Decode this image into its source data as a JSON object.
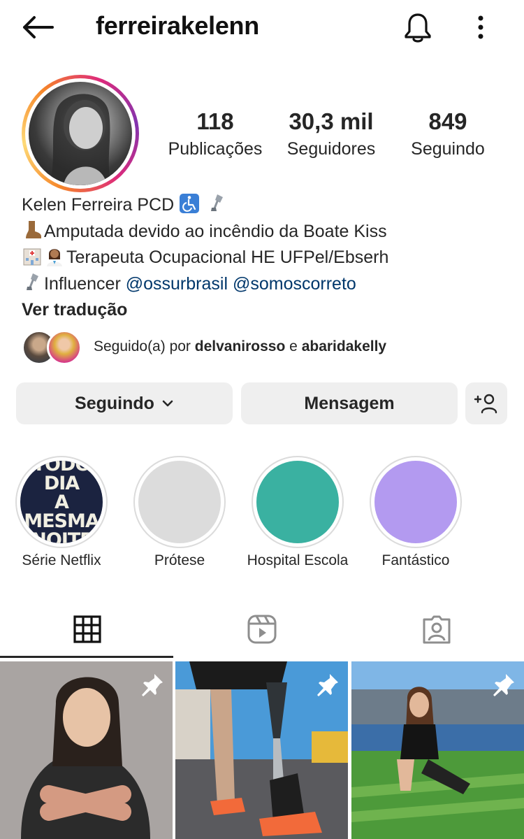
{
  "header": {
    "username": "ferreirakelenn",
    "icons": {
      "back": "arrow-left-icon",
      "notifications": "bell-icon",
      "more": "more-vertical-icon"
    }
  },
  "stats": [
    {
      "value": "118",
      "label": "Publicações"
    },
    {
      "value": "30,3 mil",
      "label": "Seguidores"
    },
    {
      "value": "849",
      "label": "Seguindo"
    }
  ],
  "bio": {
    "name": "Kelen Ferreira PCD",
    "line1": "Amputada devido ao incêndio da Boate Kiss",
    "line2": "Terapeuta Ocupacional HE UFPel/Ebserh",
    "line3_text": "Influencer",
    "mention1": "@ossurbrasil",
    "mention2": "@somoscorreto",
    "translate": "Ver tradução"
  },
  "followed_by": {
    "prefix": "Seguido(a) por",
    "user1": "delvanirosso",
    "conjunction": "e",
    "user2": "abaridakelly"
  },
  "actions": {
    "following": "Seguindo",
    "message": "Mensagem",
    "add_user_icon": "add-user-icon"
  },
  "highlights": [
    {
      "label": "Série Netflix",
      "cover_text": [
        "TODO DIA",
        "A MESMA",
        "NOITE"
      ],
      "color": "#1b2340"
    },
    {
      "label": "Prótese",
      "color": "#dcdcdc"
    },
    {
      "label": "Hospital Escola",
      "color": "#3ab1a1"
    },
    {
      "label": "Fantástico",
      "color": "#b39af0"
    }
  ],
  "tabs": [
    {
      "name": "grid-tab",
      "icon": "grid-icon",
      "active": true
    },
    {
      "name": "reels-tab",
      "icon": "reels-icon",
      "active": false
    },
    {
      "name": "tagged-tab",
      "icon": "tagged-person-icon",
      "active": false
    }
  ],
  "posts": [
    {
      "pinned": true,
      "icon": "pin-icon"
    },
    {
      "pinned": true,
      "icon": "pin-icon"
    },
    {
      "pinned": true,
      "icon": "pin-icon"
    }
  ]
}
